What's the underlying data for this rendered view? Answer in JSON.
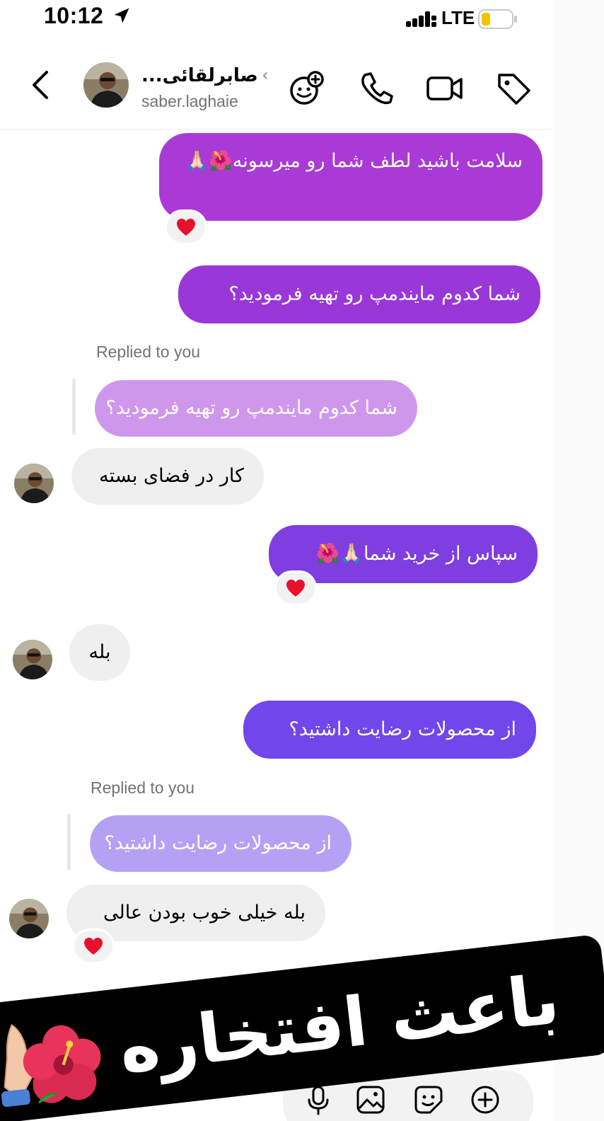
{
  "status_bar": {
    "time": "10:12",
    "network": "LTE"
  },
  "header": {
    "name": "صابرلقائی...",
    "username": "saber.laghaie"
  },
  "messages": [
    {
      "side": "sent",
      "text": "سلامت باشید لطف شما رو میرسونه🌺🙏🏻",
      "reaction": "❤️"
    },
    {
      "side": "sent",
      "text": "شما کدوم مایندمپ رو تهیه فرمودید؟"
    },
    {
      "side": "received",
      "replied_label": "Replied to you",
      "quoted": "شما کدوم مایندمپ رو تهیه فرمودید؟",
      "text": "کار در فضای بسته"
    },
    {
      "side": "sent",
      "text": "سپاس از خرید شما🙏🏻🌺",
      "reaction": "❤️"
    },
    {
      "side": "received",
      "text": "بله"
    },
    {
      "side": "sent",
      "text": "از محصولات رضایت داشتید؟"
    },
    {
      "side": "received",
      "replied_label": "Replied to you",
      "quoted": "از محصولات رضایت داشتید؟",
      "text": "بله خیلی خوب بودن عالی",
      "reaction": "❤️"
    }
  ],
  "banner": {
    "text": "باعث افتخاره"
  },
  "colors": {
    "bubble_1": "#a93ad6",
    "bubble_2": "#9a37d8",
    "bubble_3": "#7e3ee0",
    "bubble_4": "#7146ea",
    "quote_1": "#cf95ec",
    "quote_2": "#b4a0f4",
    "received": "#efefef"
  },
  "icons": [
    "location-arrow-icon",
    "signal-icon",
    "battery-icon",
    "back-icon",
    "sticker-add-icon",
    "phone-icon",
    "video-icon",
    "tag-icon",
    "heart-icon",
    "mic-icon",
    "gallery-icon",
    "sticker-icon",
    "plus-icon"
  ]
}
